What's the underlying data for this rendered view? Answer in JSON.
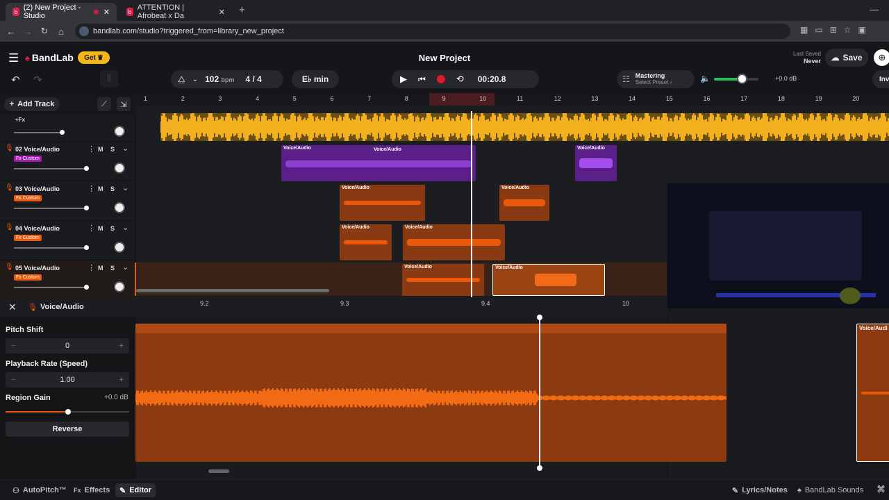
{
  "browser": {
    "tabs": [
      {
        "title": "(2) New Project - Studio"
      },
      {
        "title": "ATTENTION | Afrobeat x Da"
      }
    ],
    "url": "bandlab.com/studio?triggered_from=library_new_project"
  },
  "header": {
    "logo": "BandLab",
    "get_label": "Get",
    "project_title": "New Project",
    "last_saved_label": "Last Saved",
    "last_saved_value": "Never",
    "save_label": "Save",
    "invite_label": "Inv"
  },
  "transport": {
    "bpm_value": "102",
    "bpm_unit": "bpm",
    "time_signature": "4 / 4",
    "key": "E♭ min",
    "time": "00:20.8"
  },
  "mastering": {
    "label": "Mastering",
    "preset": "Select Preset ›"
  },
  "volume": {
    "db": "+0.0 dB",
    "level": 0.62
  },
  "add_track_label": "Add Track",
  "ruler": {
    "ticks": [
      "1",
      "2",
      "3",
      "4",
      "5",
      "6",
      "7",
      "8",
      "9",
      "10",
      "11",
      "12",
      "13",
      "14",
      "15",
      "16",
      "17",
      "18",
      "19",
      "20"
    ]
  },
  "tracks": [
    {
      "fx": "+Fx"
    },
    {
      "name": "02 Voice/Audio",
      "fx": "Fx Custom",
      "fx_color": "#a21caf"
    },
    {
      "name": "03 Voice/Audio",
      "fx": "Fx Custom",
      "fx_color": "#ea580c"
    },
    {
      "name": "04 Voice/Audio",
      "fx": "Fx Custom",
      "fx_color": "#ea580c"
    },
    {
      "name": "05 Voice/Audio",
      "fx": "Fx Custom",
      "fx_color": "#ea580c"
    }
  ],
  "mute_label": "M",
  "solo_label": "S",
  "region_label": "Voice/Audio",
  "editor": {
    "track_name": "Voice/Audio",
    "ruler_ticks": [
      "9.2",
      "9.3",
      "9.4",
      "10"
    ],
    "pitch_shift_label": "Pitch Shift",
    "pitch_shift_value": "0",
    "playback_rate_label": "Playback Rate (Speed)",
    "playback_rate_value": "1.00",
    "region_gain_label": "Region Gain",
    "region_gain_value": "+0.0 dB",
    "reverse_label": "Reverse",
    "region_label": "Voice/Audi"
  },
  "bottom": {
    "autopitch": "AutoPitch™",
    "effects": "Effects",
    "editor": "Editor",
    "lyrics": "Lyrics/Notes",
    "sounds": "BandLab Sounds"
  },
  "colors": {
    "accent_orange": "#ea580c",
    "purple": "#7e22ce",
    "yellow": "#f2b01e",
    "record_red": "#e0192d"
  }
}
